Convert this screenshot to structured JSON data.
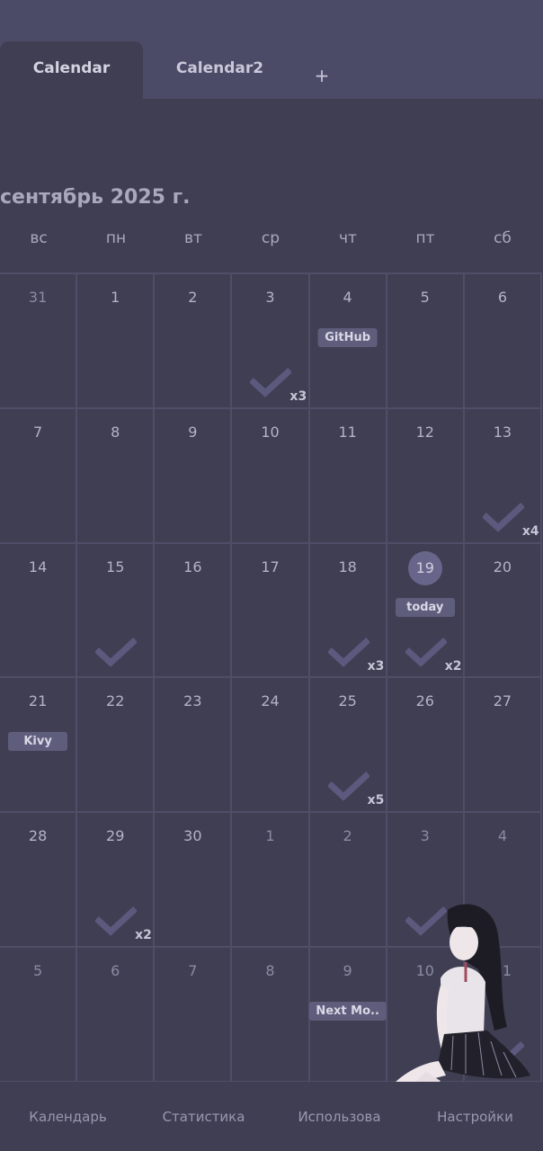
{
  "tabs": [
    {
      "label": "Calendar",
      "active": true
    },
    {
      "label": "Calendar2",
      "active": false
    }
  ],
  "add_tab_label": "+",
  "month_title": "сентябрь 2025 г.",
  "weekdays": [
    "вс",
    "пн",
    "вт",
    "ср",
    "чт",
    "пт",
    "сб"
  ],
  "weeks": [
    [
      {
        "day": "31",
        "other": true
      },
      {
        "day": "1"
      },
      {
        "day": "2"
      },
      {
        "day": "3",
        "check": true,
        "count": "x3"
      },
      {
        "day": "4",
        "tag": "GitHub"
      },
      {
        "day": "5"
      },
      {
        "day": "6"
      }
    ],
    [
      {
        "day": "7"
      },
      {
        "day": "8"
      },
      {
        "day": "9"
      },
      {
        "day": "10"
      },
      {
        "day": "11"
      },
      {
        "day": "12"
      },
      {
        "day": "13",
        "check": true,
        "count": "x4"
      }
    ],
    [
      {
        "day": "14"
      },
      {
        "day": "15",
        "check": true
      },
      {
        "day": "16"
      },
      {
        "day": "17"
      },
      {
        "day": "18",
        "check": true,
        "count": "x3"
      },
      {
        "day": "19",
        "today": true,
        "tag": "today",
        "check": true,
        "count": "x2"
      },
      {
        "day": "20"
      }
    ],
    [
      {
        "day": "21",
        "tag": "Kivy"
      },
      {
        "day": "22"
      },
      {
        "day": "23"
      },
      {
        "day": "24"
      },
      {
        "day": "25",
        "check": true,
        "count": "x5"
      },
      {
        "day": "26"
      },
      {
        "day": "27"
      }
    ],
    [
      {
        "day": "28"
      },
      {
        "day": "29",
        "check": true,
        "count": "x2"
      },
      {
        "day": "30"
      },
      {
        "day": "1",
        "other": true
      },
      {
        "day": "2",
        "other": true
      },
      {
        "day": "3",
        "other": true,
        "check": true
      },
      {
        "day": "4",
        "other": true
      }
    ],
    [
      {
        "day": "5",
        "other": true
      },
      {
        "day": "6",
        "other": true
      },
      {
        "day": "7",
        "other": true
      },
      {
        "day": "8",
        "other": true
      },
      {
        "day": "9",
        "other": true,
        "tag": "Next Mo.."
      },
      {
        "day": "10",
        "other": true
      },
      {
        "day": "11",
        "other": true,
        "check": true
      }
    ]
  ],
  "bottom_nav": [
    "Календарь",
    "Статистика",
    "Использова",
    "Настройки"
  ],
  "colors": {
    "background": "#3f3e52",
    "topbar": "#4b4a67",
    "check": "#5b5a7e",
    "tag": "#5e5d7c",
    "today_circle": "#67668a"
  },
  "icons": {
    "check": "checkmark-icon",
    "add": "plus-icon"
  }
}
